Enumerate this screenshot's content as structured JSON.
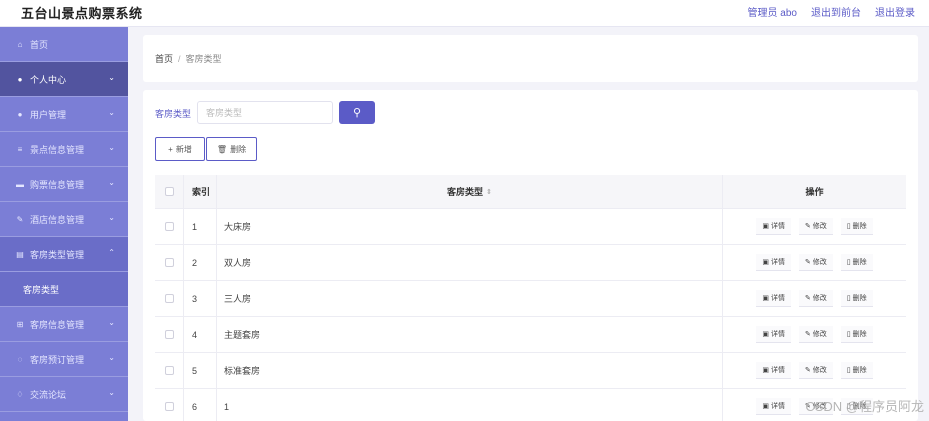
{
  "app": {
    "title": "五台山景点购票系统",
    "admin_label": "管理员 abo",
    "front_label": "退出到前台",
    "logout_label": "退出登录"
  },
  "sidebar": {
    "items": [
      {
        "label": "首页",
        "icon": "home-icon",
        "glyph": "⌂"
      },
      {
        "label": "个人中心",
        "icon": "user-icon",
        "glyph": "●",
        "chev": "⌄"
      },
      {
        "label": "用户管理",
        "icon": "user-icon",
        "glyph": "●",
        "chev": "⌄"
      },
      {
        "label": "景点信息管理",
        "icon": "sliders-icon",
        "glyph": "≡",
        "chev": "⌄"
      },
      {
        "label": "购票信息管理",
        "icon": "folder-icon",
        "glyph": "▬",
        "chev": "⌄"
      },
      {
        "label": "酒店信息管理",
        "icon": "edit-icon",
        "glyph": "✎",
        "chev": "⌄"
      },
      {
        "label": "客房类型管理",
        "icon": "document-icon",
        "glyph": "▤",
        "chev": "⌃"
      },
      {
        "label": "客房信息管理",
        "icon": "grid-icon",
        "glyph": "⊞",
        "chev": "⌄"
      },
      {
        "label": "客房预订管理",
        "icon": "clock-icon",
        "glyph": "◌",
        "chev": "⌄"
      },
      {
        "label": "交流论坛",
        "icon": "bell-icon",
        "glyph": "♢",
        "chev": "⌄"
      }
    ],
    "sub_item": "客房类型"
  },
  "breadcrumb": {
    "home": "首页",
    "sep": "/",
    "current": "客房类型"
  },
  "search": {
    "label": "客房类型",
    "placeholder": "客房类型",
    "button_icon": "search-icon",
    "glyph": "⚲"
  },
  "actions": {
    "add_label": "新增",
    "add_glyph": "+",
    "delete_label": "删除",
    "delete_glyph": "🗑"
  },
  "table": {
    "headers": {
      "index": "索引",
      "type": "客房类型",
      "sort_glyph": "⇕",
      "ops": "操作"
    },
    "ops": {
      "detail": "详情",
      "detail_glyph": "▣",
      "edit": "修改",
      "edit_glyph": "✎",
      "delete": "删除",
      "delete_glyph": "▯"
    },
    "rows": [
      {
        "index": "1",
        "type": "大床房"
      },
      {
        "index": "2",
        "type": "双人房"
      },
      {
        "index": "3",
        "type": "三人房"
      },
      {
        "index": "4",
        "type": "主题套房"
      },
      {
        "index": "5",
        "type": "标准套房"
      },
      {
        "index": "6",
        "type": "1"
      }
    ]
  },
  "watermark": "CSDN @程序员阿龙",
  "colors": {
    "accent": "#5b5bc7",
    "sidebar": "#7b7ed6",
    "sidebar_dark": "#52549f"
  }
}
